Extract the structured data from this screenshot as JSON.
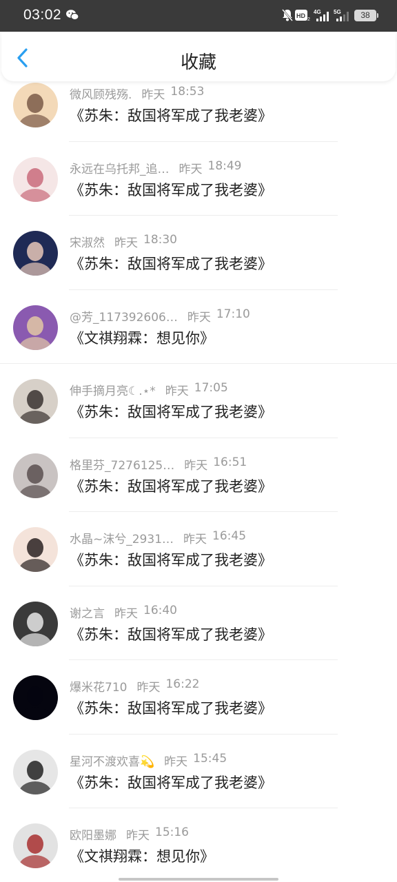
{
  "status_bar": {
    "time": "03:02",
    "battery": "38",
    "icons": [
      "wechat-icon",
      "mute-bell-icon",
      "hd-icon",
      "4g-signal-icon",
      "5g-signal-icon",
      "battery-icon"
    ]
  },
  "header": {
    "title": "收藏",
    "back_icon": "chevron-left-icon",
    "accent_color": "#2a9ff0"
  },
  "items": [
    {
      "user": "微风顾残殇.",
      "day": "昨天",
      "time": "18:53",
      "title": "《苏朱：敌国将军成了我老婆》",
      "avatar_colors": [
        "#f3d9b8",
        "#7a5a48"
      ]
    },
    {
      "user": "永远在乌托邦_追…",
      "day": "昨天",
      "time": "18:49",
      "title": "《苏朱：敌国将军成了我老婆》",
      "avatar_colors": [
        "#f5e6e6",
        "#c96b7b"
      ]
    },
    {
      "user": "宋淑然",
      "day": "昨天",
      "time": "18:30",
      "title": "《苏朱：敌国将军成了我老婆》",
      "avatar_colors": [
        "#1f2a55",
        "#e8c7b8"
      ]
    },
    {
      "user": "@芳_117392606…",
      "day": "昨天",
      "time": "17:10",
      "title": "《文祺翔霖：想见你》",
      "avatar_colors": [
        "#8a5ab0",
        "#e2c8a4"
      ]
    },
    {
      "user": "伸手摘月亮☾.⋆*",
      "day": "昨天",
      "time": "17:05",
      "title": "《苏朱：敌国将军成了我老婆》",
      "avatar_colors": [
        "#d7d0c8",
        "#3a3330"
      ]
    },
    {
      "user": "格里芬_7276125…",
      "day": "昨天",
      "time": "16:51",
      "title": "《苏朱：敌国将军成了我老婆》",
      "avatar_colors": [
        "#c9c3c2",
        "#5a5050"
      ]
    },
    {
      "user": "水晶~沫兮_2931…",
      "day": "昨天",
      "time": "16:45",
      "title": "《苏朱：敌国将军成了我老婆》",
      "avatar_colors": [
        "#f4e3da",
        "#2a2222"
      ]
    },
    {
      "user": "谢之言",
      "day": "昨天",
      "time": "16:40",
      "title": "《苏朱：敌国将军成了我老婆》",
      "avatar_colors": [
        "#3a3a3a",
        "#e8e8e8"
      ]
    },
    {
      "user": "爆米花710",
      "day": "昨天",
      "time": "16:22",
      "title": "《苏朱：敌国将军成了我老婆》",
      "avatar_colors": [
        "#05050f",
        "#05050f"
      ]
    },
    {
      "user": "星河不渡欢喜💫",
      "day": "昨天",
      "time": "15:45",
      "title": "《苏朱：敌国将军成了我老婆》",
      "avatar_colors": [
        "#e6e6e6",
        "#222222"
      ]
    },
    {
      "user": "欧阳墨娜",
      "day": "昨天",
      "time": "15:16",
      "title": "《文祺翔霖：想见你》",
      "avatar_colors": [
        "#e2e2e2",
        "#a83030"
      ]
    }
  ]
}
